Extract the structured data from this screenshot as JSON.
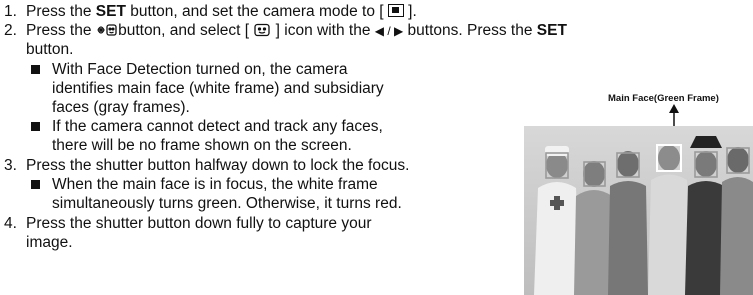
{
  "steps": [
    {
      "num": "1.",
      "pre": "Press the ",
      "bold": "SET",
      "post": " button, and set the camera mode to [ ",
      "end": " ]."
    },
    {
      "num": "2.",
      "pre": "Press the ",
      "mid": " button, and select [ ",
      "mid2": " ] icon with the ",
      "arrows": "◀ / ▶",
      "post": " buttons. Press the ",
      "bold": "SET",
      "cont": "button."
    },
    {
      "num": "3.",
      "text": "Press the shutter button halfway down to lock the focus."
    },
    {
      "num": "4.",
      "line1": "Press the shutter button down fully to capture your",
      "line2": "image."
    }
  ],
  "bullets": {
    "b1": [
      "With Face Detection turned on, the camera",
      "identifies main face (white frame) and subsidiary",
      "faces (gray frames)."
    ],
    "b2": [
      "If the camera cannot detect and track any faces,",
      "there will be no frame shown on the screen."
    ],
    "b3": [
      "When the main face is in focus, the white frame",
      "simultaneously turns green. Otherwise, it turns red."
    ]
  },
  "figure": {
    "caption": "Main Face(Green Frame)"
  },
  "icons": [
    "camera-mode-icon",
    "macro-face-button-icon",
    "face-detection-icon",
    "bullet-square-icon",
    "arrow-up-icon"
  ]
}
